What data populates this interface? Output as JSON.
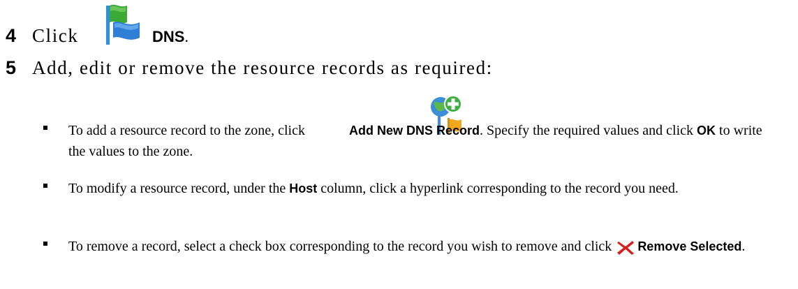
{
  "step4": {
    "number": "4",
    "click_word": "Click",
    "button_label": "DNS",
    "period": ".",
    "icon": "dns-flag-icon"
  },
  "step5": {
    "number": "5",
    "text": "Add, edit or remove the resource records as required:"
  },
  "bullets": [
    {
      "pre": "To add a resource record to the zone, click ",
      "icon": "add-dns-record-icon",
      "label": "Add New DNS Record",
      "mid1": ". Specify the required values and click ",
      "label2": "OK",
      "post": " to write the values to the zone."
    },
    {
      "pre": "To modify a resource record, under the ",
      "label": "Host",
      "post": " column, click a hyperlink corresponding to the record you need."
    },
    {
      "pre": "To remove a record, select a check box corresponding to the record you wish to remove and click ",
      "icon": "remove-x-icon",
      "label": "Remove Selected",
      "post": "."
    }
  ],
  "colors": {
    "flag_green": "#3aa935",
    "flag_blue": "#2f7fd6",
    "add_green": "#3cb043",
    "remove_red": "#d81e1e"
  }
}
